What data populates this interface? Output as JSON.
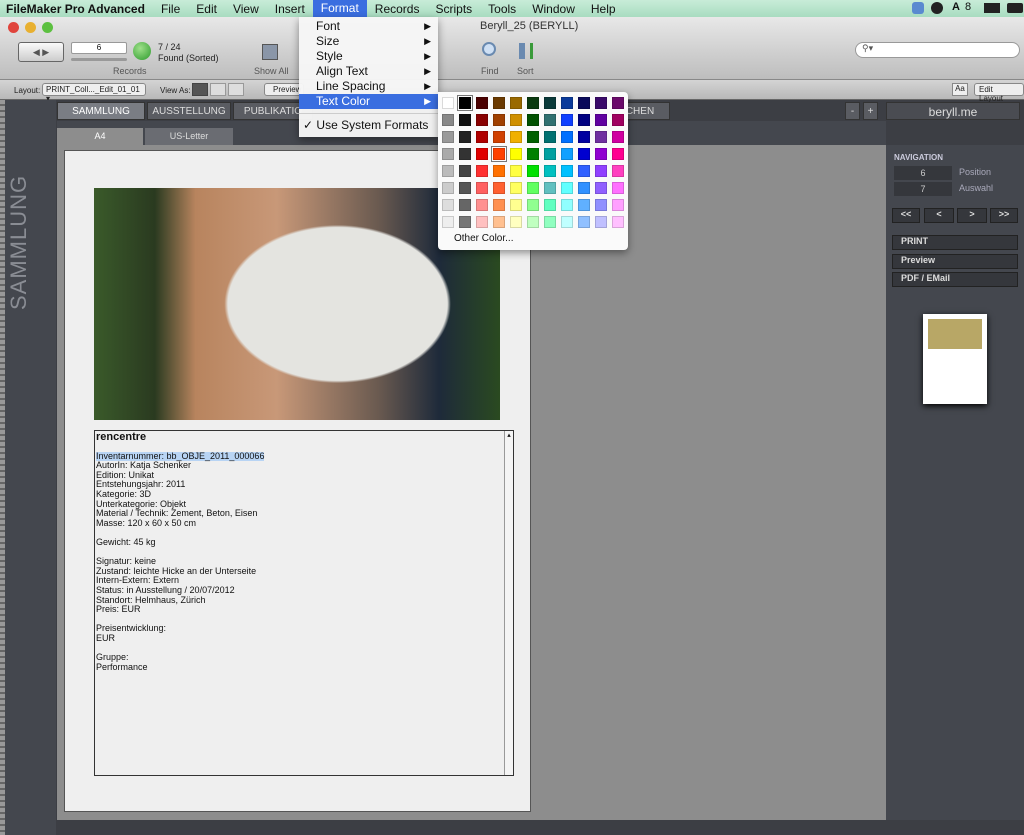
{
  "menubar": {
    "app": "FileMaker Pro Advanced",
    "items": [
      "File",
      "Edit",
      "View",
      "Insert",
      "Format",
      "Records",
      "Scripts",
      "Tools",
      "Window",
      "Help"
    ],
    "active": "Format",
    "status_num": "8"
  },
  "window": {
    "title": "Beryll_25 (BERYLL)"
  },
  "toolbar": {
    "record_value": "6",
    "found": "7 / 24",
    "found_status": "Found (Sorted)",
    "records_label": "Records",
    "show_all": "Show All",
    "find": "Find",
    "sort": "Sort",
    "search_placeholder": ""
  },
  "layoutbar": {
    "layout_label": "Layout:",
    "layout_value": "PRINT_Coll..._Edit_01_01",
    "view_as": "View As:",
    "preview": "Preview",
    "font_btn": "Aa",
    "edit_layout": "Edit Layout"
  },
  "tabs": [
    "SAMMLUNG",
    "AUSSTELLUNG",
    "PUBLIKATIO",
    "CHEN"
  ],
  "zoom_minus": "-",
  "zoom_plus": "+",
  "site": "beryll.me",
  "subtabs": [
    "A4",
    "US-Letter"
  ],
  "sidebar_title": "SAMMLUNG",
  "format_menu": {
    "items": [
      {
        "label": "Font",
        "sub": true
      },
      {
        "label": "Size",
        "sub": true
      },
      {
        "label": "Style",
        "sub": true
      },
      {
        "label": "Align Text",
        "sub": true
      },
      {
        "label": "Line Spacing",
        "sub": true
      },
      {
        "label": "Text Color",
        "sub": true,
        "selected": true
      }
    ],
    "system_formats": "Use System Formats",
    "checked": "✓"
  },
  "color_picker": {
    "other": "Other Color...",
    "selected": "#ff4000",
    "colors": [
      [
        "#ffffff",
        "#000000",
        "#4a0000",
        "#6b3a00",
        "#9a6a00",
        "#0a3a10",
        "#0a3a3a",
        "#0a3a9a",
        "#0a0a5a",
        "#3a0a6a",
        "#6a0a6a"
      ],
      [
        "#888888",
        "#111111",
        "#880000",
        "#a04000",
        "#d09000",
        "#005000",
        "#307070",
        "#1040ff",
        "#000080",
        "#6000a0",
        "#a00060"
      ],
      [
        "#999999",
        "#222222",
        "#b00000",
        "#d04000",
        "#f0b000",
        "#006000",
        "#007070",
        "#0070ff",
        "#0000a0",
        "#7030a0",
        "#d000a0"
      ],
      [
        "#aaaaaa",
        "#333333",
        "#e00000",
        "#ff4000",
        "#ffff00",
        "#008000",
        "#00a0a0",
        "#10a0ff",
        "#0000d0",
        "#9000d0",
        "#ff0090"
      ],
      [
        "#bbbbbb",
        "#444444",
        "#ff3030",
        "#ff7000",
        "#ffff40",
        "#00e000",
        "#00c0c0",
        "#00c0ff",
        "#3060ff",
        "#9040ff",
        "#ff40c0"
      ],
      [
        "#cccccc",
        "#555555",
        "#ff6060",
        "#ff6030",
        "#ffff60",
        "#60ff60",
        "#60c0c0",
        "#60ffff",
        "#3090ff",
        "#9060ff",
        "#ff70ff"
      ],
      [
        "#dddddd",
        "#666666",
        "#ff9090",
        "#ff9050",
        "#ffff90",
        "#90ff90",
        "#60ffc0",
        "#90ffff",
        "#60b0ff",
        "#9090ff",
        "#ffa0ff"
      ],
      [
        "#eeeeee",
        "#777777",
        "#ffc0c0",
        "#ffc090",
        "#ffffc0",
        "#c0ffc0",
        "#90ffc0",
        "#c0ffff",
        "#90c0ff",
        "#c0c0ff",
        "#ffc0ff"
      ]
    ]
  },
  "record": {
    "title": "rencentre",
    "lines": [
      "Inventarnummer: bb_OBJE_2011_000066",
      "AutorIn: Katja Schenker",
      "Edition: Unikat",
      "Entstehungsjahr: 2011",
      "Kategorie: 3D",
      "Unterkategorie: Objekt",
      "Material / Technik: Zement, Beton, Eisen",
      "Masse: 120 x 60 x 50 cm",
      "",
      "Gewicht: 45 kg",
      "",
      "Signatur: keine",
      "Zustand: leichte Hicke an der Unterseite",
      "Intern-Extern: Extern",
      "Status: in Ausstellung / 20/07/2012",
      "Standort: Helmhaus, Zürich",
      "Preis: EUR",
      "",
      "Preisentwicklung:",
      "EUR",
      "",
      "Gruppe:",
      "Performance"
    ]
  },
  "navigation": {
    "title": "NAVIGATION",
    "position_value": "6",
    "position_label": "Position",
    "selection_value": "7",
    "selection_label": "Auswahl",
    "buttons": [
      "<<",
      "<",
      ">",
      ">>"
    ],
    "actions": [
      "PRINT",
      "Preview",
      "PDF / EMail"
    ]
  }
}
